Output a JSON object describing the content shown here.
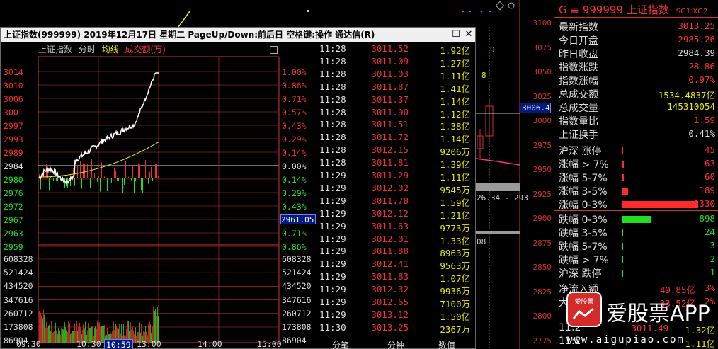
{
  "background_chart": {
    "price_axis": [
      "3100",
      "3075",
      "3050",
      "3025",
      "3000",
      "2975",
      "2950",
      "2925",
      "2900",
      "2875",
      "2850",
      "2825",
      "2800",
      "2775"
    ],
    "cursor_value": "3006.4",
    "label_8": "8",
    "label_9": "9",
    "range_label": "26.34 - 293",
    "label_08": "08"
  },
  "popup": {
    "title": "上证指数(999999)  2019年12月17日 星期二  PageUp/Down:前后日 空格键:操作 通达信(R)",
    "restore_btn": "☐",
    "close_btn": "✕",
    "head": {
      "name": "上证指数",
      "mode": "分时",
      "avg": "均线",
      "vol": "成交额(万)"
    },
    "price_left": [
      "3014",
      "3010",
      "3006",
      "3001",
      "2997",
      "2993",
      "2989",
      "2984",
      "2980",
      "2976",
      "2972",
      "2967",
      "2963",
      "2959"
    ],
    "pct_right": [
      "1.00%",
      "0.86%",
      "0.71%",
      "0.57%",
      "0.43%",
      "0.29%",
      "0.14%",
      "0.00%",
      "0.14%",
      "0.29%",
      "0.43%",
      "0.57%",
      "0.71%",
      "0.86%"
    ],
    "vol_left": [
      "608328",
      "521424",
      "434520",
      "347616",
      "260712",
      "173808",
      "86904"
    ],
    "vol_right": [
      "608328",
      "521424",
      "434520",
      "347616",
      "260712",
      "173808",
      "86904"
    ],
    "cursor_price": "2961.05",
    "time_labels": [
      "09:30",
      "10:30",
      "10:59",
      "13:00",
      "14:00",
      "15:00"
    ],
    "ticks": [
      {
        "t": "11:28",
        "p": "3011.52",
        "v": "1.92亿"
      },
      {
        "t": "11:28",
        "p": "3011.09",
        "v": "1.27亿"
      },
      {
        "t": "11:28",
        "p": "3011.03",
        "v": "1.11亿"
      },
      {
        "t": "11:28",
        "p": "3011.87",
        "v": "1.41亿"
      },
      {
        "t": "11:28",
        "p": "3011.37",
        "v": "1.14亿"
      },
      {
        "t": "11:28",
        "p": "3011.90",
        "v": "1.12亿"
      },
      {
        "t": "11:28",
        "p": "3011.51",
        "v": "1.38亿"
      },
      {
        "t": "11:28",
        "p": "3011.72",
        "v": "1.14亿"
      },
      {
        "t": "11:28",
        "p": "3012.15",
        "v": "9206万"
      },
      {
        "t": "11:28",
        "p": "3011.81",
        "v": "1.39亿"
      },
      {
        "t": "11:29",
        "p": "3011.29",
        "v": "1.11亿"
      },
      {
        "t": "11:29",
        "p": "3012.02",
        "v": "9545万"
      },
      {
        "t": "11:29",
        "p": "3011.78",
        "v": "1.59亿"
      },
      {
        "t": "11:29",
        "p": "3012.12",
        "v": "1.21亿"
      },
      {
        "t": "11:29",
        "p": "3011.63",
        "v": "9773万"
      },
      {
        "t": "11:29",
        "p": "3012.01",
        "v": "1.33亿"
      },
      {
        "t": "11:29",
        "p": "3011.88",
        "v": "8963万"
      },
      {
        "t": "11:29",
        "p": "3012.41",
        "v": "9563万"
      },
      {
        "t": "11:29",
        "p": "3011.83",
        "v": "1.07亿"
      },
      {
        "t": "11:29",
        "p": "3012.32",
        "v": "9936万"
      },
      {
        "t": "11:29",
        "p": "3012.65",
        "v": "7100万"
      },
      {
        "t": "11:29",
        "p": "3013.12",
        "v": "1.50亿"
      },
      {
        "t": "11:30",
        "p": "3013.25",
        "v": "2367万"
      }
    ],
    "tabs": [
      "分笔",
      "分钟",
      "数值"
    ]
  },
  "side": {
    "header": "G ≡ 999999 上证指数",
    "tag": "SG1 XG2",
    "stats": [
      {
        "k": "最新指数",
        "v": "3013.25",
        "c": "#ff3333"
      },
      {
        "k": "今日开盘",
        "v": "2985.26",
        "c": "#ff3333"
      },
      {
        "k": "昨日收盘",
        "v": "2984.39",
        "c": "#dddddd"
      },
      {
        "k": "指数涨跌",
        "v": "28.86",
        "c": "#ff3333"
      },
      {
        "k": "指数涨幅",
        "v": "0.97%",
        "c": "#ff3333"
      },
      {
        "k": "总成交额",
        "v": "1534.4837亿",
        "c": "#e8e800"
      },
      {
        "k": "总成交量",
        "v": "145310054",
        "c": "#e8e800"
      },
      {
        "k": "指数量比",
        "v": "1.59",
        "c": "#ff3333"
      },
      {
        "k": "上证换手",
        "v": "0.41%",
        "c": "#dddddd"
      }
    ],
    "up_dist": [
      {
        "k": "沪深 涨停",
        "v": "45"
      },
      {
        "k": "涨幅 > 7%",
        "v": "63"
      },
      {
        "k": "涨幅 5-7%",
        "v": "60"
      },
      {
        "k": "涨幅 3-5%",
        "v": "189"
      },
      {
        "k": "涨幅 0-3%",
        "v": "2330"
      }
    ],
    "down_dist": [
      {
        "k": "跌幅 0-3%",
        "v": "898"
      },
      {
        "k": "跌幅 3-5%",
        "v": "24"
      },
      {
        "k": "跌幅 5-7%",
        "v": "3"
      },
      {
        "k": "跌幅 > 7%",
        "v": "2"
      },
      {
        "k": "沪深 跌停",
        "v": "1"
      }
    ],
    "flow": [
      {
        "k": "净流入额",
        "v": "49.85亿",
        "pct": "3%"
      },
      {
        "k": "大宗流入",
        "v": "33.52亿",
        "pct": "2%"
      }
    ],
    "partial_rows": [
      {
        "t": "11:2",
        "p": "3011.49",
        "v": "1.32亿"
      },
      {
        "t": "11:2",
        "p": "",
        "v": "1.11亿"
      }
    ]
  },
  "watermark": {
    "logo": "爱股票",
    "text": "爱股票APP",
    "url": "www.aigupiao.com"
  }
}
